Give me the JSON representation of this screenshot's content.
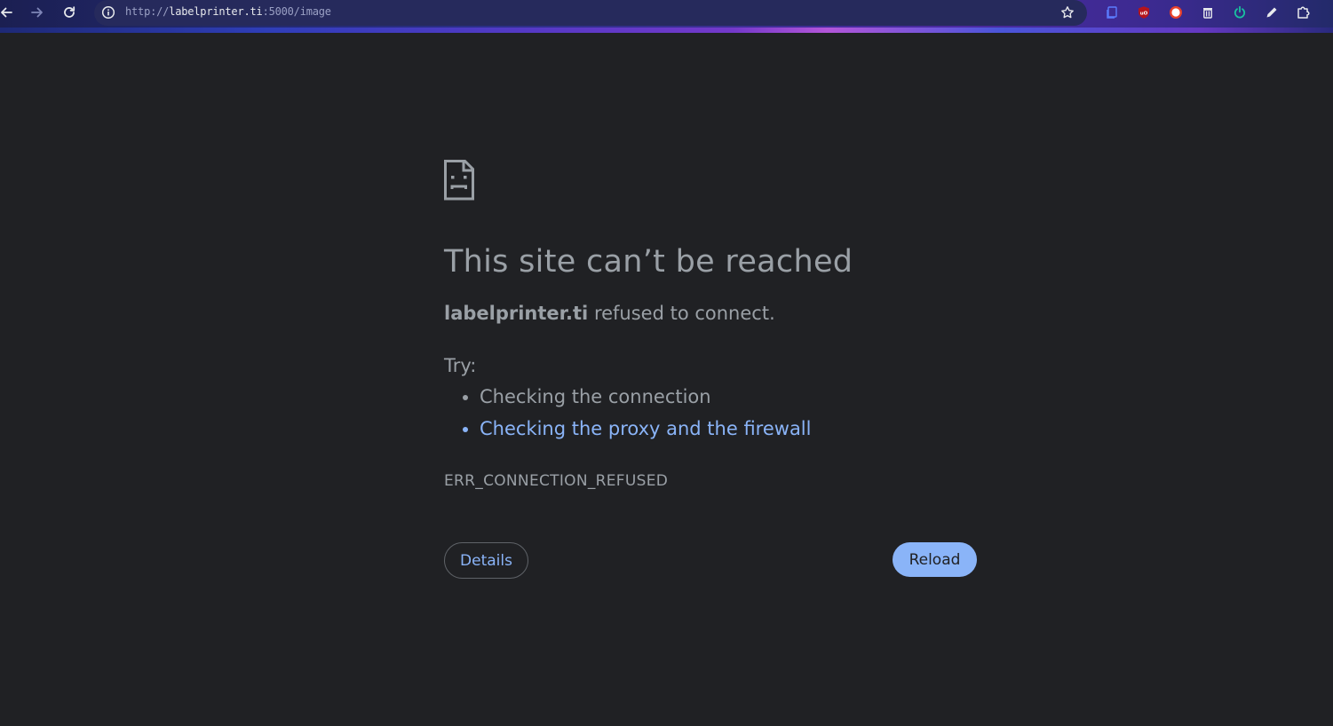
{
  "browser": {
    "url_scheme": "http://",
    "url_host": "labelprinter.ti",
    "url_rest": ":5000/image",
    "icons": {
      "back": "arrow-left-icon",
      "forward": "arrow-right-icon",
      "reload": "reload-icon",
      "site_info": "info-icon",
      "bookmark": "star-icon"
    },
    "extensions": [
      {
        "name": "copy-ext-icon",
        "color": "#5b7cff"
      },
      {
        "name": "ublock-ext-icon",
        "label": "uO",
        "color": "#b5141c"
      },
      {
        "name": "record-ext-icon",
        "color": "#e8412b"
      },
      {
        "name": "trash-ext-icon",
        "color": "#e8eaed"
      },
      {
        "name": "power-ext-icon",
        "color": "#19c2a0"
      },
      {
        "name": "pen-ext-icon",
        "color": "#e8eaed"
      },
      {
        "name": "puzzle-ext-icon",
        "color": "#e8eaed"
      }
    ]
  },
  "error": {
    "icon": "sad-page-icon",
    "title": "This site can’t be reached",
    "host": "labelprinter.ti",
    "message": "refused to connect.",
    "try_label": "Try:",
    "suggestions": [
      {
        "text": "Checking the connection",
        "link": false
      },
      {
        "text": "Checking the proxy and the firewall",
        "link": true
      }
    ],
    "code": "ERR_CONNECTION_REFUSED",
    "details_label": "Details",
    "reload_label": "Reload"
  },
  "colors": {
    "background": "#202124",
    "text": "#9aa0a6",
    "link": "#8ab4f8",
    "reload_bg": "#8ab4f8"
  }
}
